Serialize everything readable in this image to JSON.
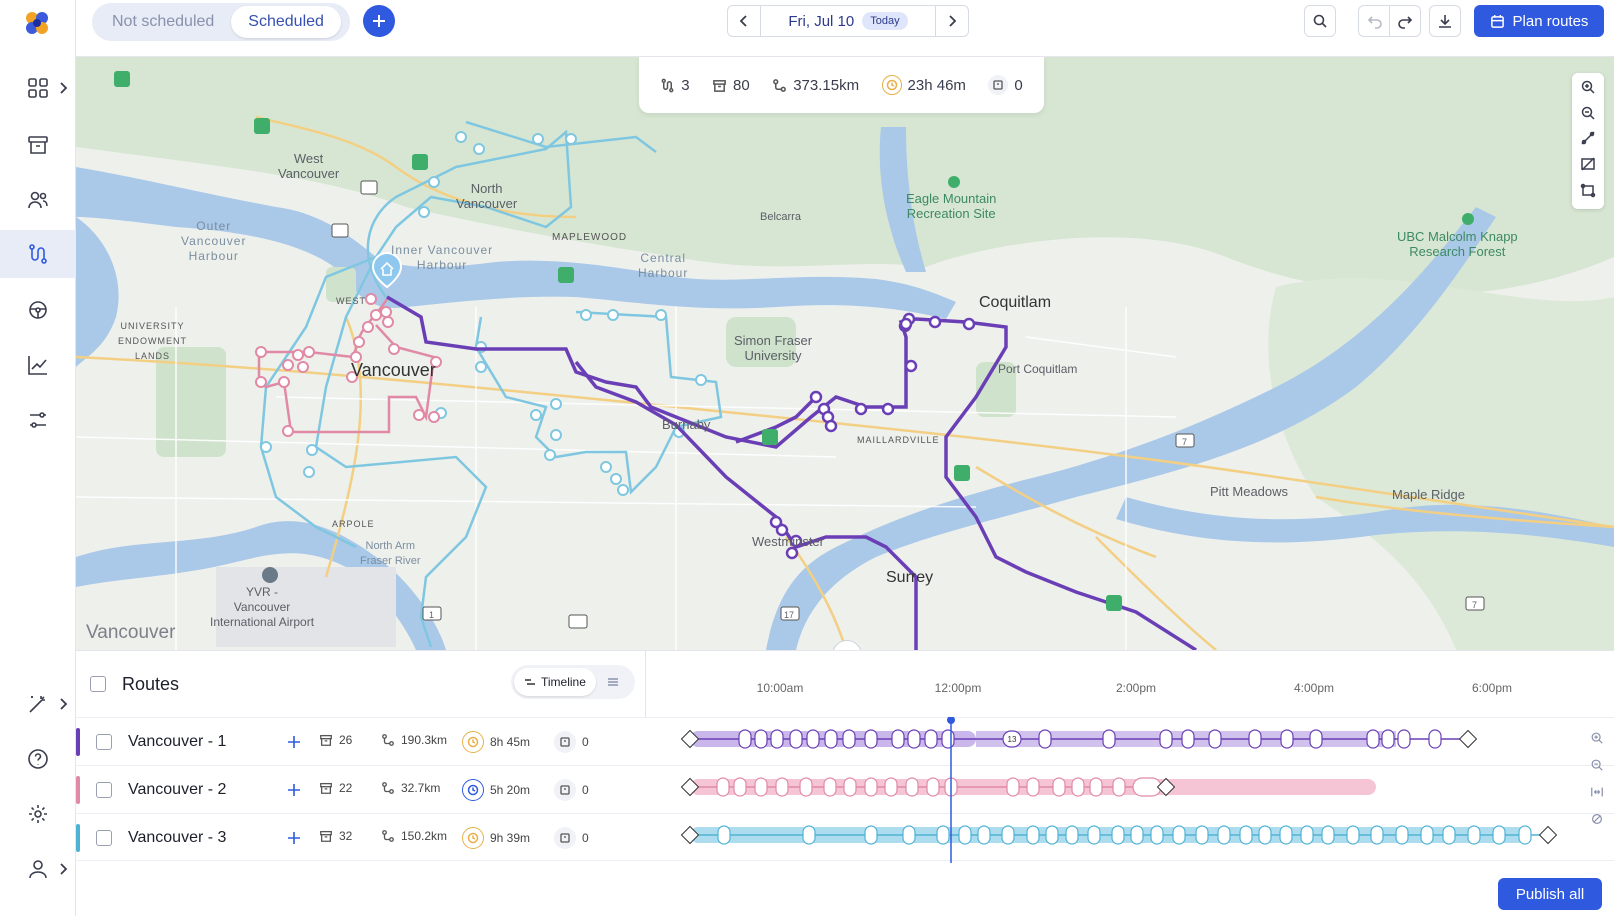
{
  "topbar": {
    "tabs": [
      {
        "label": "Not scheduled",
        "selected": false
      },
      {
        "label": "Scheduled",
        "selected": true
      }
    ],
    "date": "Fri, Jul 10",
    "today_badge": "Today",
    "plan_label": "Plan routes"
  },
  "map": {
    "stats": {
      "routes": "3",
      "stops": "80",
      "distance": "373.15km",
      "duration": "23h 46m",
      "unassigned": "0"
    },
    "labels": {
      "west_vancouver": "West\nVancouver",
      "north_vancouver": "North\nVancouver",
      "outer_harbour": "Outer\nVancouver\nHarbour",
      "inner_harbour": "Inner Vancouver\nHarbour",
      "belcarra": "Belcarra",
      "maplewood": "MAPLEWOOD",
      "central_harbour": "Central\nHarbour",
      "eagle_mountain": "Eagle Mountain\nRecreation Site",
      "coquitlam": "Coquitlam",
      "port_coquitlam": "Port Coquitlam",
      "ubc_forest": "UBC Malcolm Knapp\nResearch Forest",
      "sfu": "Simon Fraser\nUniversity",
      "university_lands": "UNIVERSITY\nENDOWMENT\nLANDS",
      "west": "WEST",
      "vancouver": "Vancouver",
      "burnaby": "Burnaby",
      "maillardville": "MAILLARDVILLE",
      "pitt_meadows": "Pitt Meadows",
      "maple_ridge": "Maple Ridge",
      "marpole": "ARPOLE",
      "north_arm": "North Arm\nFraser River",
      "yvr": "YVR -\nVancouver\nInternational Airport",
      "new_westminster": "Westminster",
      "surrey": "Surrey",
      "hwy7a": "7",
      "hwy7b": "7",
      "hwy17": "17",
      "hwy1": "1"
    },
    "brand": "Vancouver",
    "colors": {
      "route1": "#6a3fb5",
      "route2": "#e08aa6",
      "route3": "#7fc7e0"
    }
  },
  "panel": {
    "title": "Routes",
    "view_toggle": "Timeline",
    "time_ticks": [
      "10:00am",
      "12:00pm",
      "2:00pm",
      "4:00pm",
      "6:00pm"
    ],
    "routes": [
      {
        "name": "Vancouver - 1",
        "stops": "26",
        "distance": "190.3km",
        "duration": "8h 45m",
        "unassigned": "0",
        "color": "#6a3fb5"
      },
      {
        "name": "Vancouver - 2",
        "stops": "22",
        "distance": "32.7km",
        "duration": "5h 20m",
        "unassigned": "0",
        "color": "#e08aa6"
      },
      {
        "name": "Vancouver - 3",
        "stops": "32",
        "distance": "150.2km",
        "duration": "9h 39m",
        "unassigned": "0",
        "color": "#4fb3d4"
      }
    ],
    "cluster_badge": "13",
    "publish_label": "Publish all"
  }
}
